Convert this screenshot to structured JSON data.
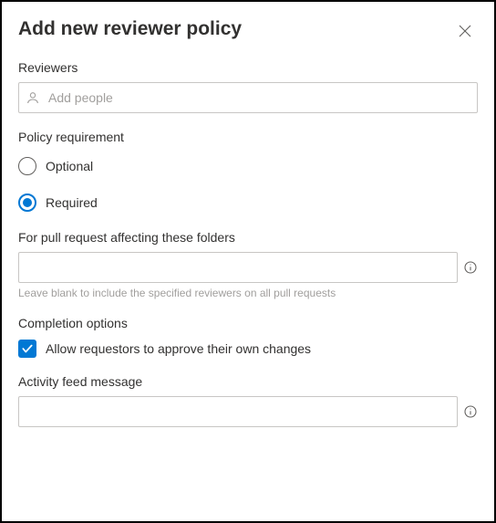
{
  "dialog": {
    "title": "Add new reviewer policy"
  },
  "reviewers": {
    "label": "Reviewers",
    "placeholder": "Add people"
  },
  "policy_requirement": {
    "label": "Policy requirement",
    "options": [
      {
        "label": "Optional",
        "selected": false
      },
      {
        "label": "Required",
        "selected": true
      }
    ]
  },
  "folders": {
    "label": "For pull request affecting these folders",
    "value": "",
    "hint": "Leave blank to include the specified reviewers on all pull requests"
  },
  "completion": {
    "label": "Completion options",
    "checkbox_label": "Allow requestors to approve their own changes",
    "checked": true
  },
  "activity": {
    "label": "Activity feed message",
    "value": ""
  }
}
